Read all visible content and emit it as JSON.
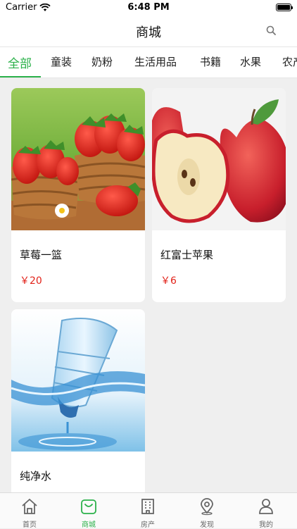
{
  "status_bar": {
    "carrier": "Carrier",
    "time": "6:48 PM"
  },
  "nav": {
    "title": "商城"
  },
  "tabs": [
    "全部",
    "童装",
    "奶粉",
    "生活用品",
    "书籍",
    "水果",
    "农产"
  ],
  "products": [
    {
      "name": "草莓一篮",
      "price": "￥20"
    },
    {
      "name": "红富士苹果",
      "price": "￥6"
    },
    {
      "name": "纯净水",
      "price": ""
    }
  ],
  "tabbar": [
    "首页",
    "商城",
    "房产",
    "发现",
    "我的"
  ],
  "colors": {
    "accent": "#2bb14a",
    "price": "#e2231a"
  }
}
